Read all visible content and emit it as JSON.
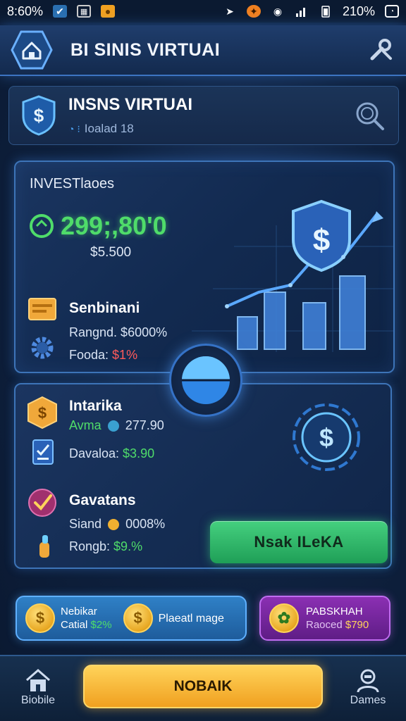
{
  "status_bar": {
    "time": "8:60%",
    "battery": "210%"
  },
  "header": {
    "title": "BI SINIS VIRTUAI"
  },
  "profile": {
    "title": "INSNS VIRTUAI",
    "subtitle": "Ioalad 18"
  },
  "investment": {
    "label": "INVESTlaoes",
    "amount": "299;,80'0",
    "sub_amount": "$5.500",
    "items": [
      {
        "title": "Senbinani",
        "line1": "Rangnd. $6000%",
        "line2_label": "Fooda: ",
        "line2_value": "$1%"
      }
    ]
  },
  "details": {
    "items": [
      {
        "title": "Intarika",
        "line1_label": "Avma",
        "line1_value": "277.90",
        "line2_label": "Davaloa: ",
        "line2_value": "$3.90"
      },
      {
        "title": "Gavatans",
        "line1_label": "Siand",
        "line1_value": "0008%",
        "line2_label": "Rongb: ",
        "line2_value": "$9.%"
      }
    ],
    "cta_label": "Nsak ILeKA"
  },
  "cards": {
    "blue": {
      "line1": "Nebikar",
      "line2_label": "Catial",
      "line2_value": "$2%",
      "right_label": "Plaeatl mage"
    },
    "purple": {
      "line1": "PABSKHAH",
      "line2_label": "Raoced",
      "line2_value": "$790"
    }
  },
  "bottom_nav": {
    "left_label": "Biobile",
    "main_label": "NOBAIK",
    "right_label": "Dames"
  },
  "colors": {
    "accent_green": "#4fdc6a",
    "accent_blue": "#3d74b8",
    "accent_gold": "#f0a020",
    "accent_purple": "#8b2fb3",
    "alert_red": "#ff5a5a"
  }
}
